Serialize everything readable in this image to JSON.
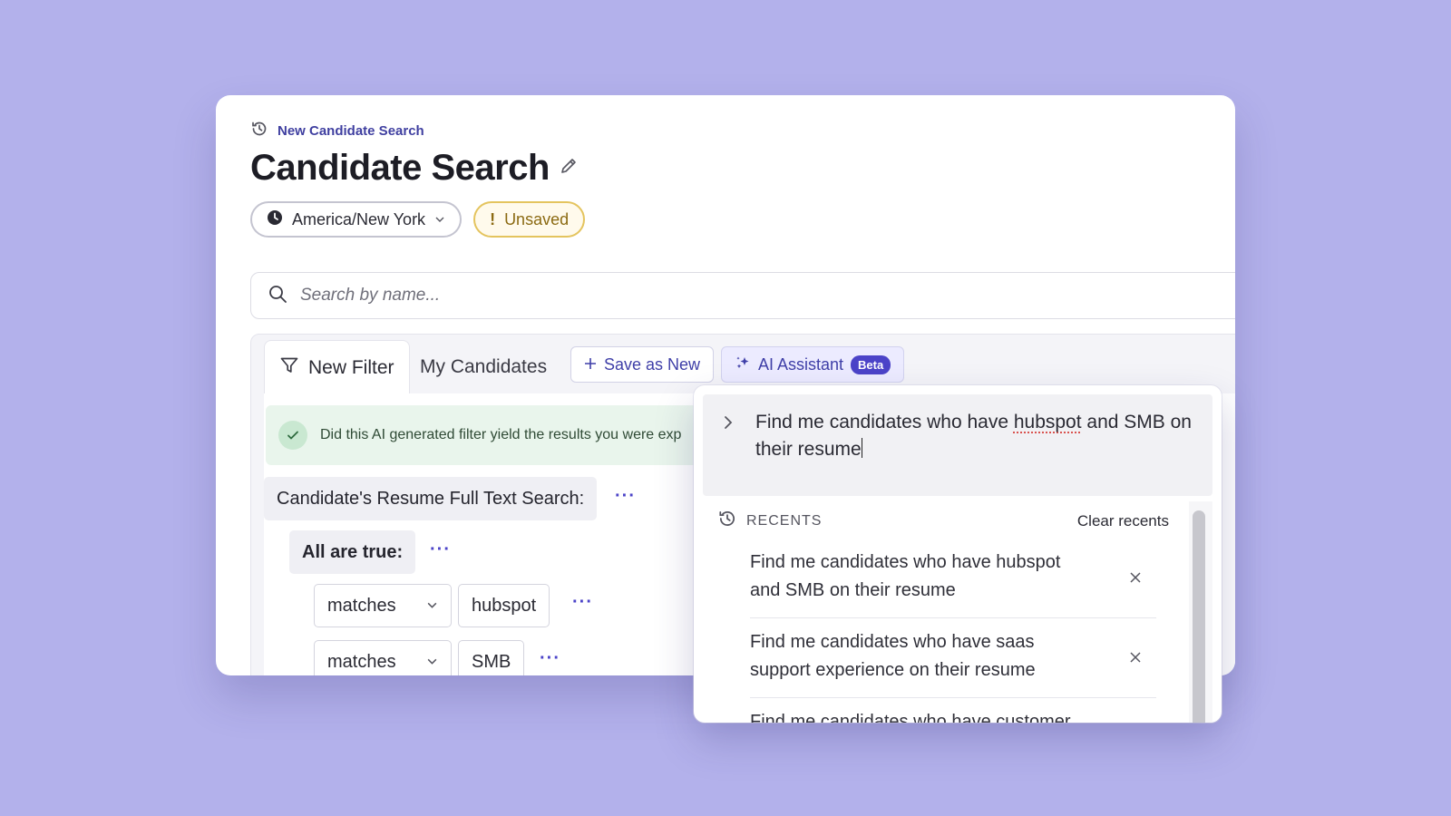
{
  "header": {
    "breadcrumb": "New Candidate Search",
    "title": "Candidate Search"
  },
  "pills": {
    "timezone": "America/New York",
    "status": "Unsaved"
  },
  "search": {
    "placeholder": "Search by name..."
  },
  "tabs": {
    "new_filter": "New Filter",
    "my_candidates": "My Candidates",
    "save_as_new": "Save as New",
    "ai_assistant": "AI Assistant",
    "beta": "Beta"
  },
  "feedback": {
    "text": "Did this AI generated filter yield the results you were exp"
  },
  "filter": {
    "root_label": "Candidate's Resume Full Text Search:",
    "group_label": "All are true:",
    "conditions": [
      {
        "operator": "matches",
        "value": "hubspot"
      },
      {
        "operator": "matches",
        "value": "SMB"
      }
    ]
  },
  "ai_dropdown": {
    "query_part1": "Find me candidates who have ",
    "query_misspelled": "hubspot",
    "query_part2": " and SMB on their resume",
    "recents_label": "RECENTS",
    "clear_recents": "Clear recents",
    "recents": [
      "Find me candidates who have hubspot and SMB on their resume",
      "Find me candidates who have saas support experience on their resume",
      "Find me candidates who have customer experience"
    ]
  },
  "colors": {
    "background": "#b3b1eb",
    "accent": "#4b43c8",
    "unsaved_border": "#e4c45e",
    "success_bg": "#e9f5ec"
  }
}
